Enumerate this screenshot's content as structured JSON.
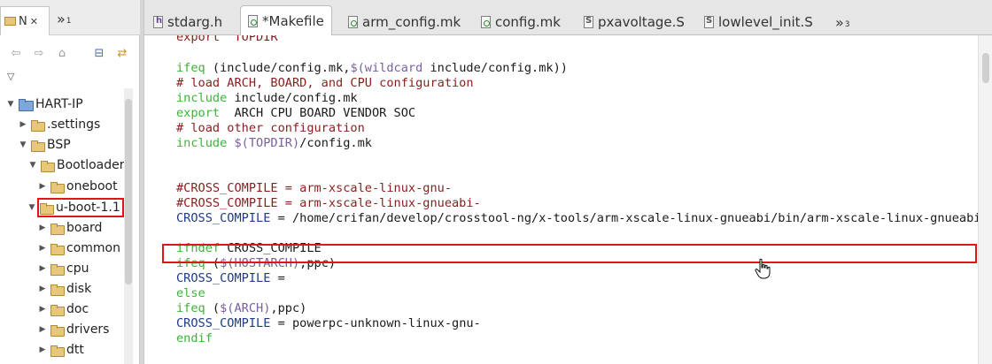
{
  "navigator": {
    "tab_label": "N",
    "more_tabs_label": "»",
    "more_tabs_count": "1",
    "tree": [
      {
        "label": "HART-IP",
        "expanded": true,
        "type": "project"
      },
      {
        "label": ".settings",
        "expanded": false,
        "type": "folder"
      },
      {
        "label": "BSP",
        "expanded": true,
        "type": "folder"
      },
      {
        "label": "Bootloader",
        "expanded": true,
        "type": "folder"
      },
      {
        "label": "oneboot",
        "expanded": false,
        "type": "folder"
      },
      {
        "label": "u-boot-1.1",
        "expanded": true,
        "type": "folder",
        "highlighted": true
      },
      {
        "label": "board",
        "expanded": false,
        "type": "folder"
      },
      {
        "label": "common",
        "expanded": false,
        "type": "folder"
      },
      {
        "label": "cpu",
        "expanded": false,
        "type": "folder"
      },
      {
        "label": "disk",
        "expanded": false,
        "type": "folder"
      },
      {
        "label": "doc",
        "expanded": false,
        "type": "folder"
      },
      {
        "label": "drivers",
        "expanded": false,
        "type": "folder"
      },
      {
        "label": "dtt",
        "expanded": false,
        "type": "folder"
      }
    ]
  },
  "editor": {
    "tabs": [
      {
        "label": "stdarg.h",
        "icon": "header-file-icon",
        "active": false
      },
      {
        "label": "*Makefile",
        "icon": "makefile-icon",
        "active": true
      },
      {
        "label": "arm_config.mk",
        "icon": "makefile-icon",
        "active": false
      },
      {
        "label": "config.mk",
        "icon": "makefile-icon",
        "active": false
      },
      {
        "label": "pxavoltage.S",
        "icon": "asm-file-icon",
        "active": false
      },
      {
        "label": "lowlevel_init.S",
        "icon": "asm-file-icon",
        "active": false
      }
    ],
    "more_tabs_label": "»",
    "more_tabs_count": "3",
    "code": {
      "l0": "export  TOPDIR",
      "l1_kw": "ifeq",
      "l1_a": " (include/config.mk,",
      "l1_b": "$(wildcard",
      "l1_c": " include/config.mk))",
      "l2": "# load ARCH, BOARD, and CPU configuration",
      "l3_kw": "include",
      "l3_a": " include/config.mk",
      "l4_kw": "export",
      "l4_a": "  ARCH CPU BOARD VENDOR SOC",
      "l5": "# load other configuration",
      "l6_kw": "include",
      "l6_b": " $(TOPDIR)",
      "l6_c": "/config.mk",
      "l7": "#CROSS_COMPILE = arm-xscale-linux-gnu-",
      "l8": "#CROSS_COMPILE = arm-xscale-linux-gnueabi-",
      "l9_var": "CROSS_COMPILE",
      "l9_a": " = /home/crifan/develop/crosstool-ng/x-tools/arm-xscale-linux-gnueabi/bin/arm-xscale-linux-gnueabi-",
      "l10_kw": "ifndef",
      "l10_a": " CROSS_COMPILE",
      "l11_kw": "ifeq",
      "l11_a": " (",
      "l11_b": "$(HOSTARCH)",
      "l11_c": ",ppc)",
      "l12_var": "CROSS_COMPILE",
      "l12_a": " =",
      "l13_kw": "else",
      "l14_kw": "ifeq",
      "l14_a": " (",
      "l14_b": "$(ARCH)",
      "l14_c": ",ppc)",
      "l15_var": "CROSS_COMPILE",
      "l15_a": " = powerpc-unknown-linux-gnu-",
      "l16_kw": "endif"
    }
  },
  "colors": {
    "keyword": "#3ab53a",
    "comment": "#8b1d1d",
    "variable": "#1d3a8b",
    "highlight_box": "#e0141a"
  }
}
